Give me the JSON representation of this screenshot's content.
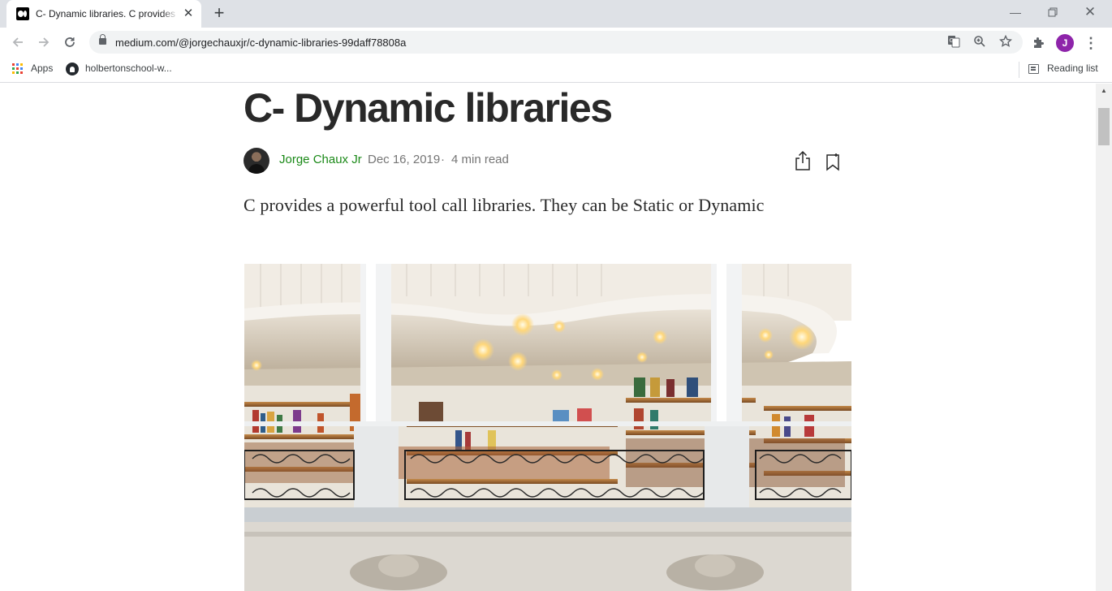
{
  "browser": {
    "tab": {
      "title": "C- Dynamic libraries. C provides a powerful tool call libraries"
    },
    "address_bar": {
      "url": "medium.com/@jorgechauxjr/c-dynamic-libraries-99daff78808a"
    },
    "profile_initial": "J",
    "profile_color": "#8e24aa",
    "bookmarks": {
      "apps_label": "Apps",
      "items": [
        {
          "label": "holbertonschool-w...",
          "icon": "github-icon"
        }
      ],
      "reading_list_label": "Reading list"
    }
  },
  "article": {
    "title": "C- Dynamic libraries",
    "author": "Jorge Chaux Jr",
    "date": "Dec 16, 2019",
    "separator": "·",
    "read_time": "4 min read",
    "subtitle": "C provides a powerful tool call libraries. They can be Static or Dynamic",
    "hero_image": "bookstore interior with white columns, balcony railing and bookshelves"
  },
  "colors": {
    "author_link": "#1a8917",
    "title_text": "#292929",
    "meta_text": "#757575",
    "tabstrip_bg": "#dee1e6"
  }
}
